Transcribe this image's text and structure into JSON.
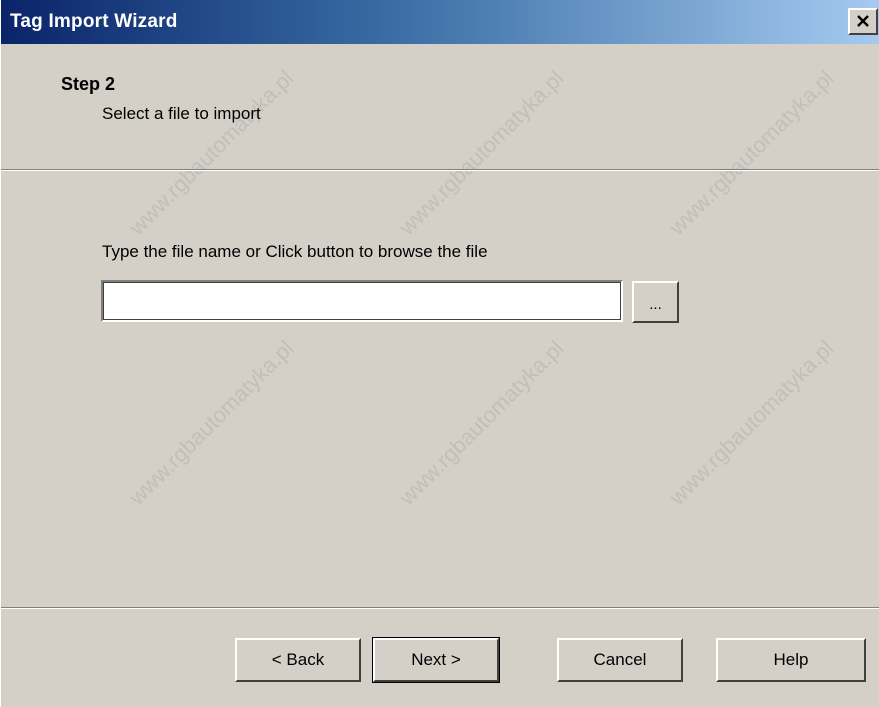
{
  "window": {
    "title": "Tag Import Wizard"
  },
  "title_bar": {
    "close_glyph": "×",
    "close_icon": "close-icon"
  },
  "step": {
    "title": "Step 2",
    "subtitle": "Select a file to import"
  },
  "file_picker": {
    "prompt": "Type the file name or Click button to browse the file",
    "value": "",
    "placeholder": "",
    "browse_label": "..."
  },
  "buttons": {
    "back": "< Back",
    "next": "Next >",
    "cancel": "Cancel",
    "help": "Help"
  },
  "watermark": {
    "text": "www.rgbautomatyka.pl"
  }
}
